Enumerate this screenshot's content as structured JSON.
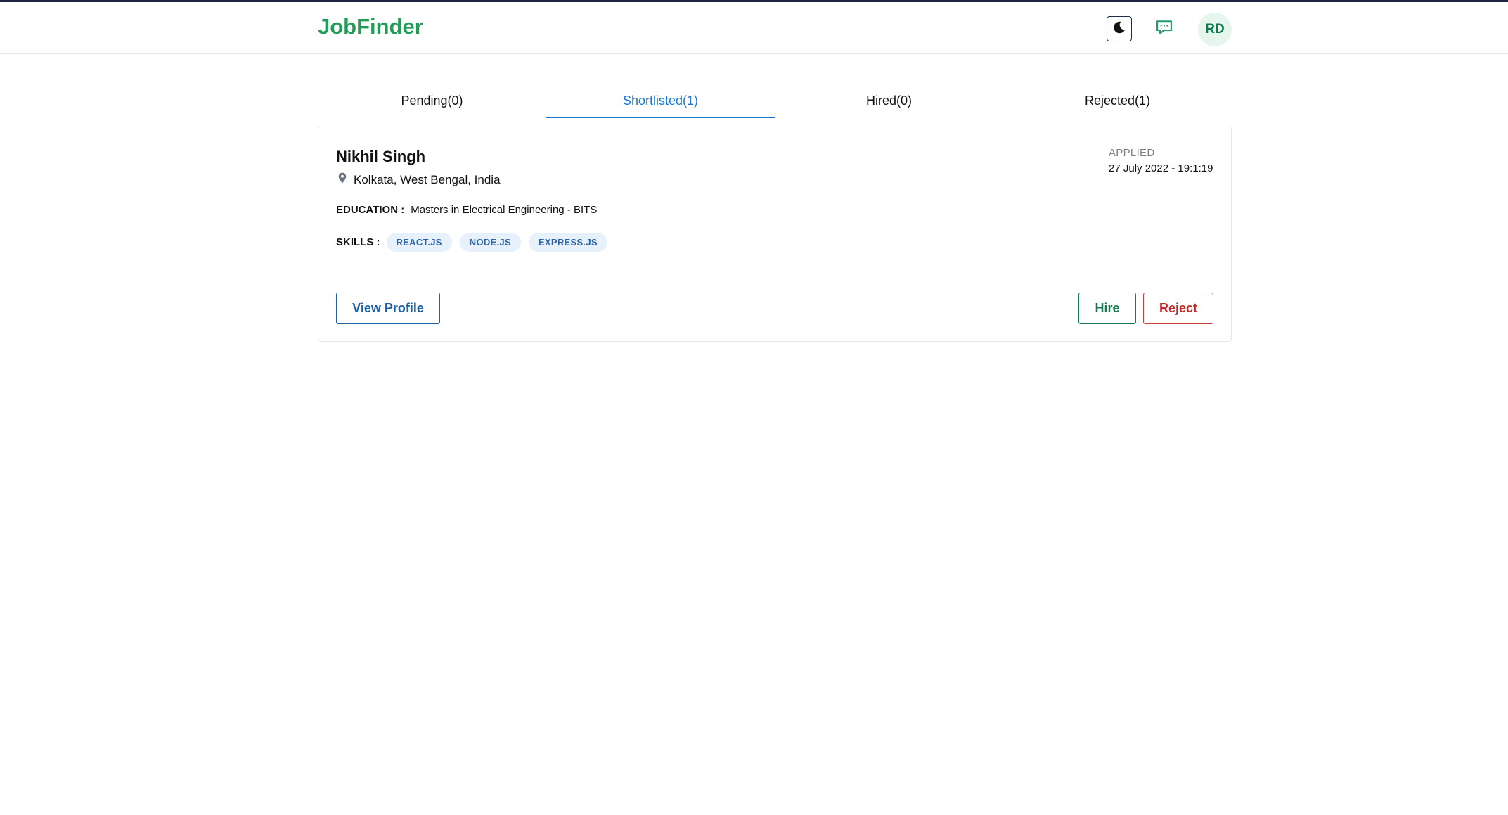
{
  "header": {
    "brand": "JobFinder",
    "avatar_initials": "RD",
    "theme_icon": "moon-icon",
    "messages_icon": "chat-icon"
  },
  "tabs": [
    {
      "label": "Pending(0)",
      "active": false
    },
    {
      "label": "Shortlisted(1)",
      "active": true
    },
    {
      "label": "Hired(0)",
      "active": false
    },
    {
      "label": "Rejected(1)",
      "active": false
    }
  ],
  "candidate": {
    "name": "Nikhil Singh",
    "location": "Kolkata, West Bengal, India",
    "applied_label": "APPLIED",
    "applied_date": "27 July 2022 - 19:1:19",
    "education_label": "EDUCATION :",
    "education": "Masters in Electrical Engineering - BITS",
    "skills_label": "SKILLS :",
    "skills": [
      "REACT.JS",
      "NODE.JS",
      "EXPRESS.JS"
    ]
  },
  "actions": {
    "view_profile": "View Profile",
    "hire": "Hire",
    "reject": "Reject"
  },
  "colors": {
    "brand": "#1f9d55",
    "active_tab": "#1976d2",
    "hire": "#187a52",
    "reject": "#c62828"
  }
}
